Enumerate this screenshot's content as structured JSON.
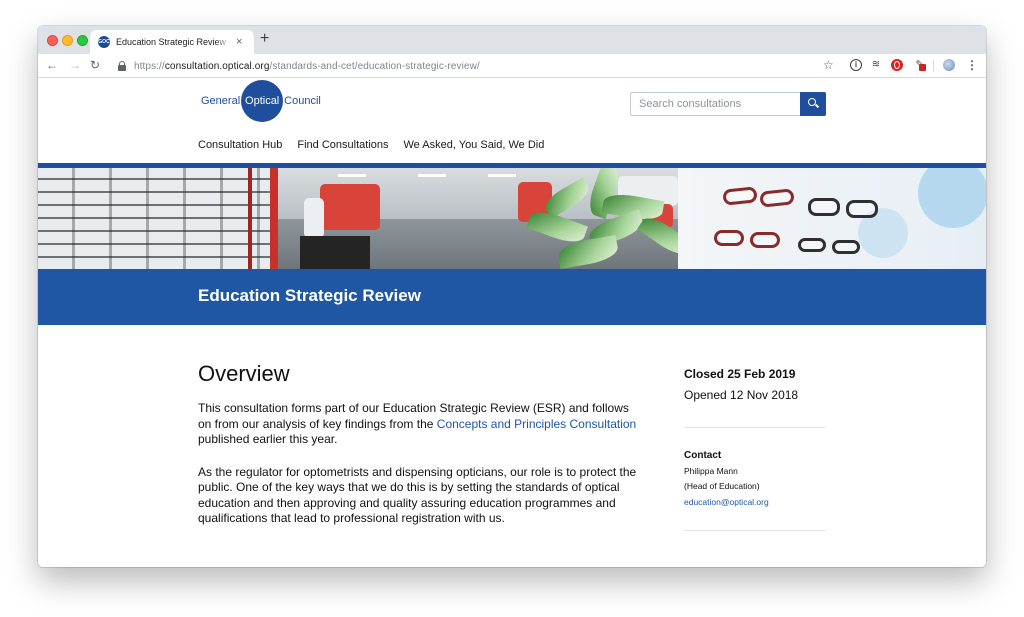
{
  "browser": {
    "tab": {
      "favicon_text": "GOC",
      "title": "Education Strategic Review - Consultation Hub",
      "close": "×"
    },
    "new_tab": "+",
    "nav": {
      "back": "←",
      "forward": "→",
      "reload": "C"
    },
    "url": {
      "scheme": "https://",
      "host": "consultation.optical.org",
      "path": "/standards-and-cet/education-strategic-review/"
    },
    "icons": [
      "star-icon",
      "info-extension-icon",
      "layers-extension-icon",
      "opera-extension-icon",
      "tool-extension-icon",
      "profile-avatar-icon",
      "menu-icon"
    ]
  },
  "site": {
    "logo": {
      "left": "General",
      "center": "Optical",
      "right": "Council"
    },
    "search": {
      "placeholder": "Search consultations",
      "value": ""
    },
    "nav": [
      "Consultation Hub",
      "Find Consultations",
      "We Asked, You Said, We Did"
    ],
    "brand_color": "#1f4f9c"
  },
  "page": {
    "heading": "Education Strategic Review",
    "overview": {
      "title": "Overview",
      "p1_before": "This consultation forms part of our Education Strategic Review (ESR) and follows on from our analysis of key findings from the ",
      "p1_link": "Concepts and Principles Consultation",
      "p1_after": " published earlier this year.",
      "p2": "As the regulator for optometrists and dispensing opticians, our role is to protect the public. One of the key ways that we do this is by setting the standards of optical education and then approving and quality assuring education programmes and qualifications that lead to professional registration with us."
    },
    "sidebar": {
      "closed": "Closed 25 Feb 2019",
      "opened": "Opened 12 Nov 2018",
      "contact_heading": "Contact",
      "contact_name": "Philippa Mann",
      "contact_role": "(Head of Education)",
      "contact_email": "education@optical.org"
    }
  }
}
